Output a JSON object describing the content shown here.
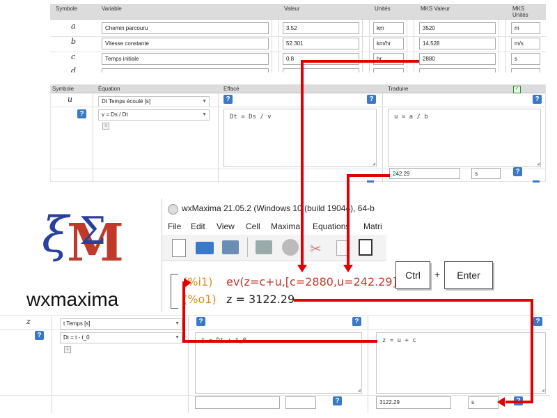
{
  "top_table": {
    "headers": {
      "symbole": "Symbole",
      "variable": "Variable",
      "valeur": "Valeur",
      "unites": "Unités",
      "mks_valeur": "MKS Valeur",
      "mks_unites_1": "MKS",
      "mks_unites_2": "Unités"
    },
    "rows": [
      {
        "symbol": "a",
        "variable": "Chemin parcouru",
        "valeur": "3.52",
        "unite": "km",
        "mks_valeur": "3520",
        "mks_unite": "m"
      },
      {
        "symbol": "b",
        "variable": "Vitesse constante",
        "valeur": "52.301",
        "unite": "km/hr",
        "mks_valeur": "14.528",
        "mks_unite": "m/s"
      },
      {
        "symbol": "c",
        "variable": "Temps initiale",
        "valeur": "0.8",
        "unite": "hr",
        "mks_valeur": "2880",
        "mks_unite": "s"
      },
      {
        "symbol": "d"
      }
    ]
  },
  "eq_table": {
    "headers": {
      "symbole": "Symbole",
      "equation": "Équation",
      "efface": "Effacé",
      "traduire": "Traduire"
    },
    "symbol": "u",
    "equation_select": "Dt Temps écoulé [s]",
    "equation_formula": "v = Ds / Dt",
    "efface_text": "Dt = Ds / v",
    "traduire_text": "u = a / b",
    "result_value": "242.29",
    "result_unit": "s"
  },
  "wxmaxima": {
    "title": "wxMaxima 21.05.2 (Windows 10 (build 19044), 64-b",
    "menu": [
      "File",
      "Edit",
      "View",
      "Cell",
      "Maxima",
      "Equations",
      "Matri"
    ],
    "input_label": "(%i1)",
    "input_prefix": "ev(z=c+u,[c=",
    "input_c": "2880",
    "input_mid": ",u=",
    "input_u": "242.29",
    "input_suffix": "]);",
    "output_label": "(%o1)",
    "output_text": "z = 3122.29",
    "logo_text": "wxmaxima",
    "logo_letter": "M",
    "logo_sigma": "Σ",
    "logo_xi": "ξ"
  },
  "keys": {
    "ctrl": "Ctrl",
    "plus": "+",
    "enter": "Enter"
  },
  "bottom_table": {
    "symbol": "z",
    "equation_select": "t Temps [s]",
    "equation_formula": "Dt = t - t_0",
    "efface_text": "t = Dt + t_0",
    "traduire_text": "z = u + c",
    "result_value": "3122.29",
    "result_unit": "s"
  },
  "colors": {
    "arrow": "#e00000",
    "help_button": "#3a78c9",
    "header_bg": "#dcdcdc",
    "maxima_red": "#c0392b",
    "maxima_blue": "#2a3f9e"
  }
}
